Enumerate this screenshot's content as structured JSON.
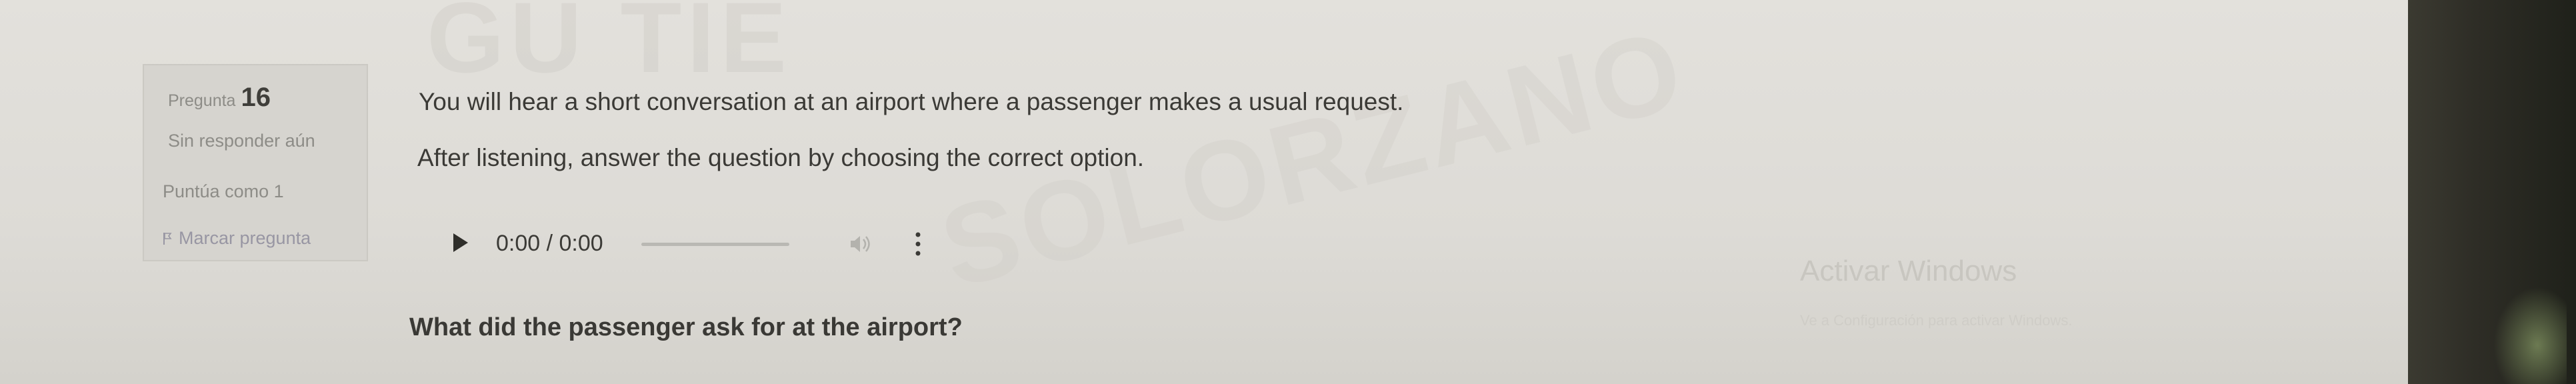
{
  "question_info": {
    "label": "Pregunta",
    "number": "16",
    "status": "Sin responder aún",
    "points": "Puntúa como 1",
    "flag_label": "Marcar pregunta"
  },
  "question": {
    "instruction_1": "You will hear a short conversation at an airport where a passenger makes a usual request.",
    "instruction_2": "After listening, answer the question by choosing the correct option.",
    "prompt": "What did the passenger ask for at the airport?"
  },
  "audio_player": {
    "time": "0:00 / 0:00",
    "progress": 0
  },
  "overlay": {
    "activation_title": "Activar Windows",
    "activation_subtitle": "Ve a Configuración para activar Windows."
  },
  "background_watermark": [
    "GU TIE",
    "SOLORZANO"
  ],
  "icons": [
    "play-icon",
    "volume-icon",
    "more-options-icon",
    "flag-icon"
  ]
}
